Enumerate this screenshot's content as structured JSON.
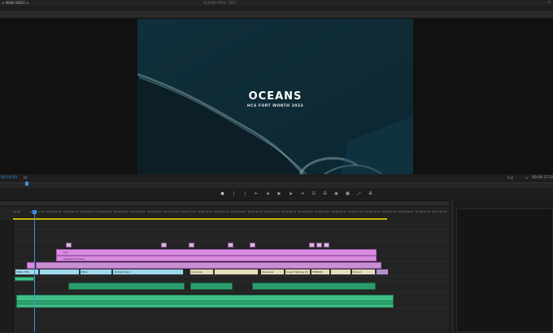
{
  "topbar": {
    "tab_main": "≡ MAIN VIDEO  ≡",
    "sequence_title": "OCEANS PROJ · EDIT",
    "menu_icon": "»"
  },
  "monitor": {
    "title": "OCEANS",
    "subtitle": "HCS FORT WORTH 2023",
    "timecode_left": "00:14:02",
    "fit_left": "Fit",
    "fit_right": "Full",
    "timecode_right": "00:04:27:20"
  },
  "transport": {
    "buttons": [
      "●",
      "|",
      "|",
      "⇤",
      "◂|",
      "▶",
      "|▸",
      "⇥",
      "⊡",
      "⊟",
      "◉",
      "▣",
      "⤢",
      "⊞"
    ]
  },
  "timeline": {
    "ruler_ticks": [
      "00:00",
      "00:04:14:22",
      "00:04:21:22",
      "00:04:28:22",
      "00:04:35:22",
      "00:04:42:22",
      "00:04:49:22",
      "00:04:56:22",
      "00:05:03:22",
      "00:05:10:22",
      "00:05:17:22",
      "00:05:24:22",
      "00:05:31:22",
      "00:05:38:22",
      "00:05:45:22",
      "00:05:52:22",
      "00:05:59:22",
      "00:06:06:22",
      "00:06:13:22",
      "00:06:20:22",
      "00:06:27:22",
      "00:06:34:22",
      "00:06:41:22",
      "00:06:48:22",
      "00:06:55:22",
      "00:07:02:22"
    ],
    "adjustment_layers": [
      "LUT",
      "Adjustment Layer"
    ],
    "video_clips": [
      {
        "name": "Water Hits"
      },
      {
        "name": "Wide"
      },
      {
        "name": "Vertical Seq 2"
      },
      {
        "name": "Cam Ang"
      },
      {
        "name": "Overview"
      },
      {
        "name": "Coast Highway 01"
      },
      {
        "name": "MISSION"
      },
      {
        "name": "Tunnel"
      }
    ]
  }
}
